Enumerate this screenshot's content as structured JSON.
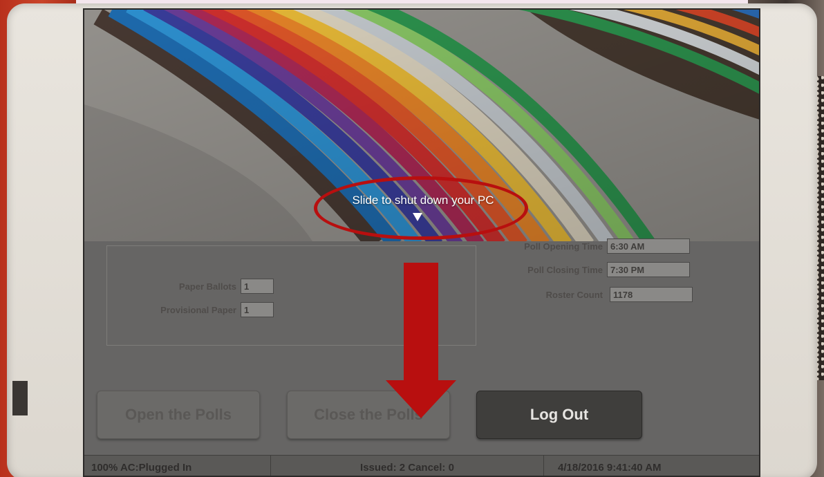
{
  "shutdown_overlay": {
    "message": "Slide to shut down your PC"
  },
  "ballots": {
    "paper_ballots_label": "Paper Ballots",
    "paper_ballots_value": "1",
    "provisional_paper_label": "Provisional Paper",
    "provisional_paper_value": "1"
  },
  "poll_info": {
    "opening_time_label": "Poll Opening Time",
    "opening_time_value": "6:30 AM",
    "closing_time_label": "Poll Closing Time",
    "closing_time_value": "7:30 PM",
    "roster_count_label": "Roster Count",
    "roster_count_value": "1178"
  },
  "actions": {
    "open_polls_label": "Open the Polls",
    "close_polls_label": "Close the Polls",
    "log_out_label": "Log Out"
  },
  "status_bar": {
    "power": "100% AC:Plugged In",
    "issued_cancel": "Issued: 2 Cancel: 0",
    "datetime": "4/18/2016 9:41:40 AM"
  },
  "colors": {
    "annotation_red": "#b80f0f",
    "wall_red": "#c9442a"
  },
  "icons": {
    "shutdown_arrow": "triangle-down",
    "annotation_arrow": "arrow-down"
  }
}
